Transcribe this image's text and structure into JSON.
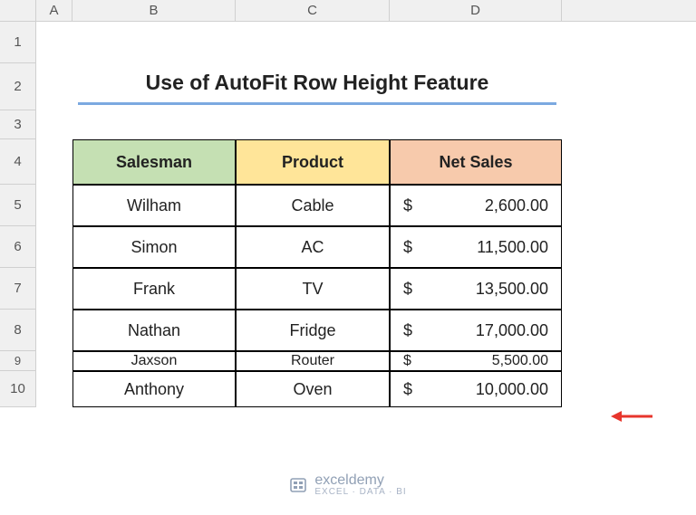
{
  "columns": [
    "A",
    "B",
    "C",
    "D"
  ],
  "rows": [
    "1",
    "2",
    "3",
    "4",
    "5",
    "6",
    "7",
    "8",
    "9",
    "10"
  ],
  "title": "Use of AutoFit Row Height Feature",
  "headers": {
    "salesman": "Salesman",
    "product": "Product",
    "netsales": "Net Sales"
  },
  "currency": "$",
  "data": [
    {
      "salesman": "Wilham",
      "product": "Cable",
      "netsales": "2,600.00"
    },
    {
      "salesman": "Simon",
      "product": "AC",
      "netsales": "11,500.00"
    },
    {
      "salesman": "Frank",
      "product": "TV",
      "netsales": "13,500.00"
    },
    {
      "salesman": "Nathan",
      "product": "Fridge",
      "netsales": "17,000.00"
    },
    {
      "salesman": "Jaxson",
      "product": "Router",
      "netsales": "5,500.00"
    },
    {
      "salesman": "Anthony",
      "product": "Oven",
      "netsales": "10,000.00"
    }
  ],
  "footer": {
    "brand": "exceldemy",
    "tag": "EXCEL · DATA · BI"
  },
  "chart_data": {
    "type": "table",
    "title": "Use of AutoFit Row Height Feature",
    "columns": [
      "Salesman",
      "Product",
      "Net Sales"
    ],
    "rows": [
      [
        "Wilham",
        "Cable",
        2600.0
      ],
      [
        "Simon",
        "AC",
        11500.0
      ],
      [
        "Frank",
        "TV",
        13500.0
      ],
      [
        "Nathan",
        "Fridge",
        17000.0
      ],
      [
        "Jaxson",
        "Router",
        5500.0
      ],
      [
        "Anthony",
        "Oven",
        10000.0
      ]
    ]
  }
}
